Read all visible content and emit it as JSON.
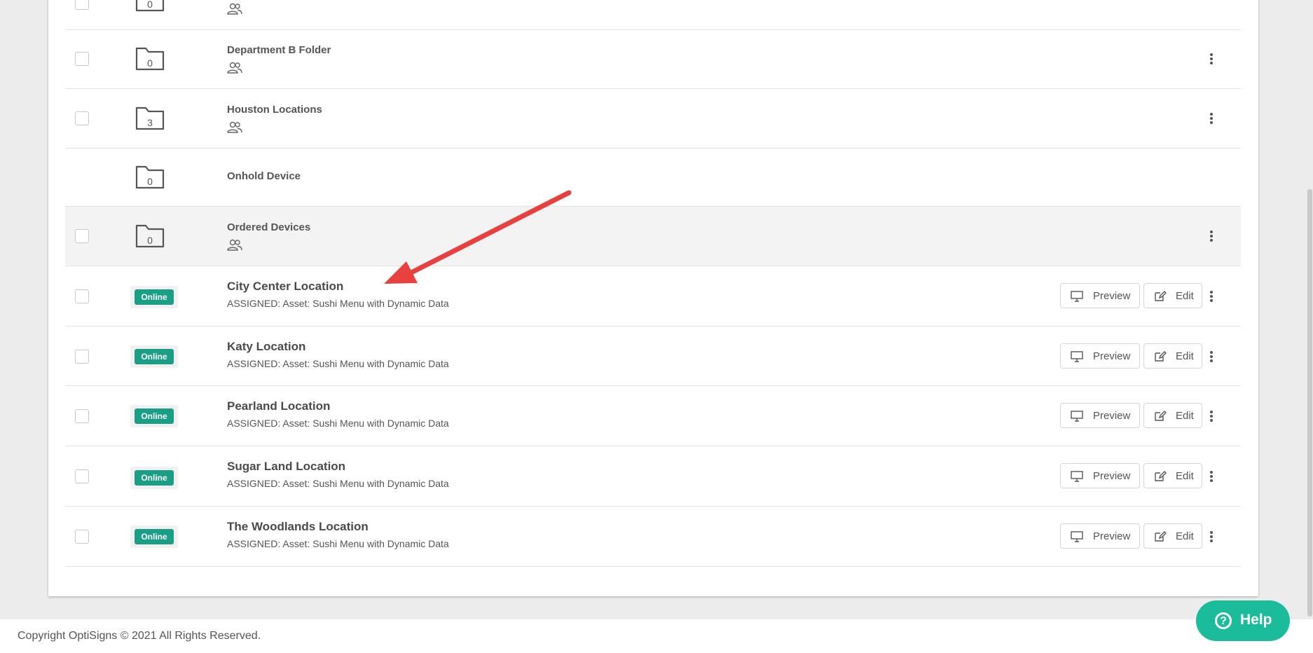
{
  "folders": [
    {
      "count": "0",
      "title": "",
      "checkbox": true,
      "group_icon": true,
      "menu": true
    },
    {
      "count": "0",
      "title": "Department B Folder",
      "checkbox": true,
      "group_icon": true,
      "menu": true
    },
    {
      "count": "3",
      "title": "Houston Locations",
      "checkbox": true,
      "group_icon": true,
      "menu": true
    },
    {
      "count": "0",
      "title": "Onhold Device",
      "checkbox": false,
      "group_icon": false,
      "menu": false
    },
    {
      "count": "0",
      "title": "Ordered Devices",
      "checkbox": true,
      "group_icon": true,
      "menu": true
    }
  ],
  "devices": [
    {
      "status": "Online",
      "title": "City Center Location",
      "assigned": "ASSIGNED: Asset: Sushi Menu with Dynamic Data"
    },
    {
      "status": "Online",
      "title": "Katy Location",
      "assigned": "ASSIGNED: Asset: Sushi Menu with Dynamic Data"
    },
    {
      "status": "Online",
      "title": "Pearland Location",
      "assigned": "ASSIGNED: Asset: Sushi Menu with Dynamic Data"
    },
    {
      "status": "Online",
      "title": "Sugar Land Location",
      "assigned": "ASSIGNED: Asset: Sushi Menu with Dynamic Data"
    },
    {
      "status": "Online",
      "title": "The Woodlands Location",
      "assigned": "ASSIGNED: Asset: Sushi Menu with Dynamic Data"
    }
  ],
  "buttons": {
    "preview": "Preview",
    "edit": "Edit"
  },
  "footer": {
    "copyright": "Copyright OptiSigns © 2021 All Rights Reserved."
  },
  "help": {
    "label": "Help"
  },
  "colors": {
    "online": "#1a9e86",
    "help": "#1abc9c",
    "arrow": "#e8403f"
  }
}
